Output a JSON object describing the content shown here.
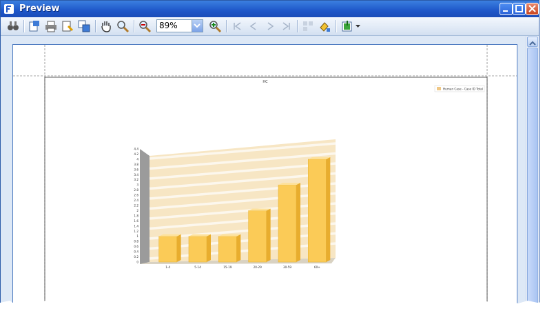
{
  "window": {
    "title": "Preview",
    "icon": "app-icon"
  },
  "toolbar": {
    "zoom_value": "89%",
    "icons": [
      "find-icon",
      "page-setup-icon",
      "print-icon",
      "quick-print-icon",
      "scale-icon",
      "hand-tool-icon",
      "magnifier-icon",
      "zoom-out-icon",
      "zoom-in-icon",
      "first-page-icon",
      "previous-page-icon",
      "next-page-icon",
      "last-page-icon",
      "multiple-pages-icon",
      "background-color-icon",
      "export-icon"
    ]
  },
  "report": {
    "header_text": "HC"
  },
  "chart_data": {
    "type": "bar",
    "categories": [
      "1-4",
      "5-14",
      "15-19",
      "20-29",
      "30-59",
      "60+"
    ],
    "series": [
      {
        "name": "Human Case - Case ID Total",
        "values": [
          1,
          1,
          1,
          2,
          3,
          4
        ]
      }
    ],
    "ylim": [
      0,
      4.4
    ],
    "yticks": [
      "0",
      "0.2",
      "0.4",
      "0.6",
      "0.8",
      "1",
      "1.2",
      "1.4",
      "1.6",
      "1.8",
      "2",
      "2.2",
      "2.4",
      "2.6",
      "2.8",
      "3",
      "3.2",
      "3.4",
      "3.6",
      "3.8",
      "4",
      "4.2",
      "4.4"
    ],
    "legend_position": "top-right",
    "colors": {
      "bar": "#fbcb57",
      "wall": "#f7e6c4",
      "floor": "#d9d2c2"
    }
  }
}
